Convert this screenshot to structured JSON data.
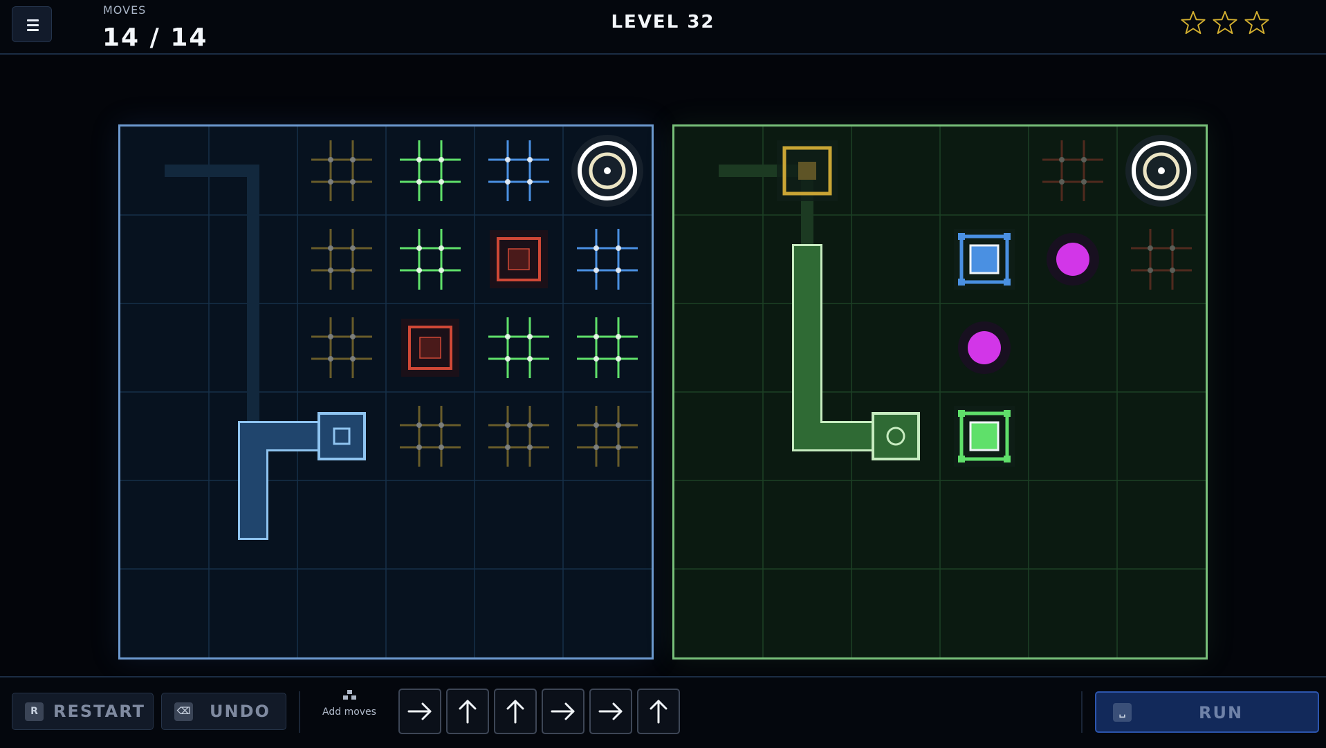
{
  "header": {
    "moves_label": "MOVES",
    "moves_count": "14 / 14",
    "level_title": "LEVEL 32",
    "stars_earned": 0,
    "stars_total": 3,
    "star_color": "#d4b030",
    "menu_icon": "hamburger-icon"
  },
  "colors": {
    "left_border": "#6d9ad0",
    "right_border": "#78c07a",
    "yellow": "#c9a535",
    "green": "#5fe06a",
    "blue": "#4a90e2",
    "red": "#d04836",
    "magenta": "#d236e8",
    "player_blue": "#8fc4f0",
    "player_green": "#c7ecc0"
  },
  "boards": {
    "left": {
      "grid_size": 6,
      "theme": "blue",
      "player_path": [
        [
          1,
          4
        ],
        [
          1,
          3
        ],
        [
          2,
          3
        ]
      ],
      "ghost_path": [
        [
          0,
          0
        ],
        [
          1,
          0
        ],
        [
          1,
          3
        ]
      ],
      "player_head": [
        2,
        3
      ],
      "exit": [
        5,
        0
      ],
      "tiles": [
        {
          "col": 2,
          "row": 0,
          "type": "grid",
          "color": "yellow"
        },
        {
          "col": 3,
          "row": 0,
          "type": "grid",
          "color": "green"
        },
        {
          "col": 4,
          "row": 0,
          "type": "grid",
          "color": "blue"
        },
        {
          "col": 2,
          "row": 1,
          "type": "grid",
          "color": "yellow"
        },
        {
          "col": 3,
          "row": 1,
          "type": "grid",
          "color": "green"
        },
        {
          "col": 4,
          "row": 1,
          "type": "block",
          "color": "red"
        },
        {
          "col": 5,
          "row": 1,
          "type": "grid",
          "color": "blue"
        },
        {
          "col": 2,
          "row": 2,
          "type": "grid",
          "color": "yellow"
        },
        {
          "col": 3,
          "row": 2,
          "type": "block",
          "color": "red"
        },
        {
          "col": 4,
          "row": 2,
          "type": "grid",
          "color": "green"
        },
        {
          "col": 5,
          "row": 2,
          "type": "grid",
          "color": "green"
        },
        {
          "col": 3,
          "row": 3,
          "type": "grid",
          "color": "yellow"
        },
        {
          "col": 4,
          "row": 3,
          "type": "grid",
          "color": "yellow"
        },
        {
          "col": 5,
          "row": 3,
          "type": "grid",
          "color": "yellow"
        }
      ]
    },
    "right": {
      "grid_size": 6,
      "theme": "green",
      "player_path": [
        [
          1,
          1
        ],
        [
          1,
          3
        ],
        [
          2,
          3
        ]
      ],
      "ghost_path": [
        [
          0,
          0
        ],
        [
          1,
          0
        ],
        [
          1,
          1
        ]
      ],
      "player_head": [
        2,
        3
      ],
      "exit": [
        5,
        0
      ],
      "tiles": [
        {
          "col": 1,
          "row": 0,
          "type": "switch",
          "color": "yellow"
        },
        {
          "col": 4,
          "row": 0,
          "type": "grid",
          "color": "red",
          "faded": true
        },
        {
          "col": 3,
          "row": 1,
          "type": "switch",
          "color": "blue"
        },
        {
          "col": 4,
          "row": 1,
          "type": "orb",
          "color": "magenta"
        },
        {
          "col": 5,
          "row": 1,
          "type": "grid",
          "color": "red",
          "faded": true
        },
        {
          "col": 3,
          "row": 2,
          "type": "orb",
          "color": "magenta"
        },
        {
          "col": 3,
          "row": 3,
          "type": "switch",
          "color": "green"
        }
      ]
    }
  },
  "controls": {
    "restart_key": "R",
    "restart_label": "RESTART",
    "undo_key": "⌫",
    "undo_label": "UNDO",
    "add_moves_label": "Add moves",
    "add_moves_icon": "blocks-icon",
    "moves": [
      "right",
      "up",
      "up",
      "right",
      "right",
      "up"
    ],
    "run_key": "␣",
    "run_label": "RUN"
  }
}
